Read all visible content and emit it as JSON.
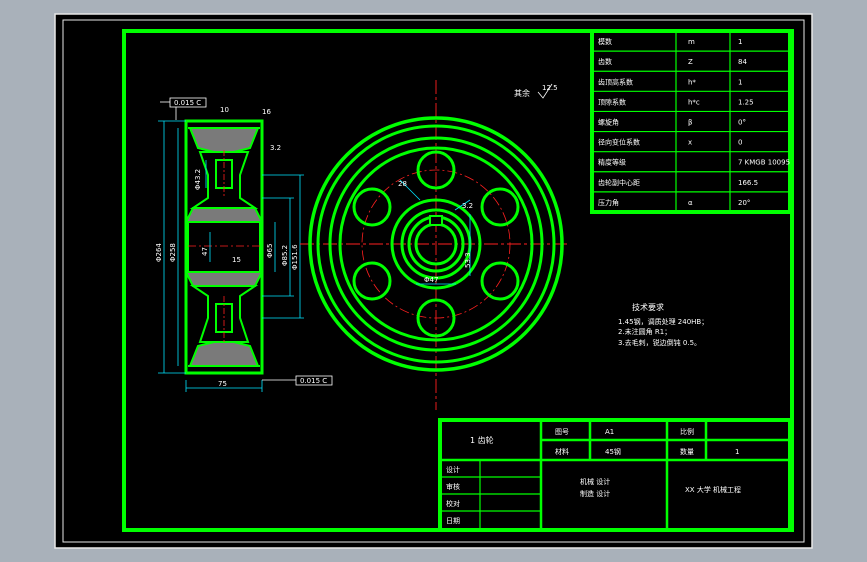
{
  "colors": {
    "background": "#a9b1ba",
    "sheet": "#000000",
    "border": "#00ff00",
    "dimension": "#00e5ff",
    "centerline": "#ff2020",
    "text": "#ffffff"
  },
  "params_table": [
    {
      "name": "模数",
      "symbol": "m",
      "value": "1"
    },
    {
      "name": "齿数",
      "symbol": "Z",
      "value": "84"
    },
    {
      "name": "齿顶高系数",
      "symbol": "h*",
      "value": "1"
    },
    {
      "name": "顶隙系数",
      "symbol": "h*c",
      "value": "1.25"
    },
    {
      "name": "螺旋角",
      "symbol": "β",
      "value": "0°"
    },
    {
      "name": "径向变位系数",
      "symbol": "x",
      "value": "0"
    },
    {
      "name": "精度等级",
      "symbol": "",
      "value": "7 KMGB 10095"
    },
    {
      "name": "齿轮副中心距",
      "symbol": "",
      "value": "166.5"
    },
    {
      "name": "压力角",
      "symbol": "α",
      "value": "20°"
    }
  ],
  "section_view": {
    "dims": [
      "Φ264",
      "Φ258",
      "Φ85.2",
      "Φ151.6",
      "Φ65",
      "Φ47",
      "Φ43.2",
      "47",
      "75",
      "15",
      "10",
      "16",
      "3.2"
    ],
    "tolerance_top": "0.015 C",
    "tolerance_bottom": "0.015 C"
  },
  "front_view": {
    "labels": [
      "Φ47",
      "28",
      "12.5",
      "3.2",
      "53.3"
    ],
    "roughness_note": "其余"
  },
  "tech_requirements": {
    "title": "技术要求",
    "lines": [
      "1.45钢，调质处理 240HB；",
      "2.未注圆角 R1；",
      "3.去毛刺，锐边倒钝 0.5。"
    ]
  },
  "title_block": {
    "part_name": "1 齿轮",
    "label_drawing_no": "图号",
    "drawing_no": "A1",
    "label_material": "材料",
    "material": "45钢",
    "label_scale": "比例",
    "scale": "",
    "label_quantity": "数量",
    "quantity": "1",
    "roles": [
      "设计",
      "审核",
      "校对",
      "日期"
    ],
    "school": [
      "机械 设计",
      "制造 设计"
    ],
    "company": "XX 大学 机械工程"
  }
}
